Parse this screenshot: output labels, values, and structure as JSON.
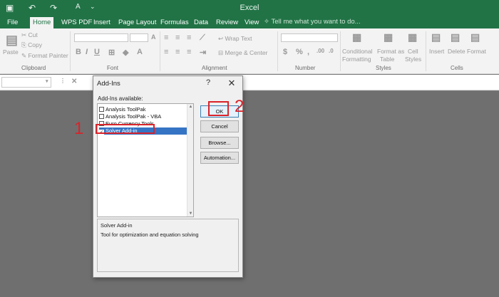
{
  "window": {
    "title": "Excel"
  },
  "tabs": [
    "File",
    "Home",
    "WPS PDF",
    "Insert",
    "Page Layout",
    "Formulas",
    "Data",
    "Review",
    "View"
  ],
  "tell_me": "Tell me what you want to do...",
  "ribbon": {
    "clipboard": {
      "paste": "Paste",
      "cut": "Cut",
      "copy": "Copy",
      "format_painter": "Format Painter",
      "label": "Clipboard"
    },
    "font": {
      "label": "Font"
    },
    "alignment": {
      "wrap_text": "Wrap Text",
      "merge_center": "Merge & Center",
      "label": "Alignment"
    },
    "number": {
      "label": "Number"
    },
    "styles": {
      "conditional": "Conditional",
      "formatting": "Formatting",
      "format_as": "Format as",
      "table": "Table",
      "cell": "Cell",
      "cell_styles": "Styles",
      "label": "Styles"
    },
    "cells": {
      "insert": "Insert",
      "delete": "Delete",
      "format": "Format",
      "label": "Cells"
    }
  },
  "dialog": {
    "title": "Add-Ins",
    "help": "?",
    "close": "✕",
    "available_label": "Add-Ins available:",
    "items": [
      {
        "label": "Analysis ToolPak",
        "checked": false,
        "selected": false
      },
      {
        "label": "Analysis ToolPak - VBA",
        "checked": false,
        "selected": false
      },
      {
        "label": "Euro Currency Tools",
        "checked": false,
        "selected": false
      },
      {
        "label": "Solver Add-in",
        "checked": true,
        "selected": true
      }
    ],
    "buttons": {
      "ok": "OK",
      "cancel": "Cancel",
      "browse": "Browse...",
      "automation": "Automation..."
    },
    "description_title": "Solver Add-in",
    "description_text": "Tool for optimization and equation solving"
  },
  "annotations": {
    "step1": "1",
    "step2": "2",
    "color": "#d9232a"
  },
  "colors": {
    "accent": "#217346",
    "selection": "#3574c4"
  }
}
